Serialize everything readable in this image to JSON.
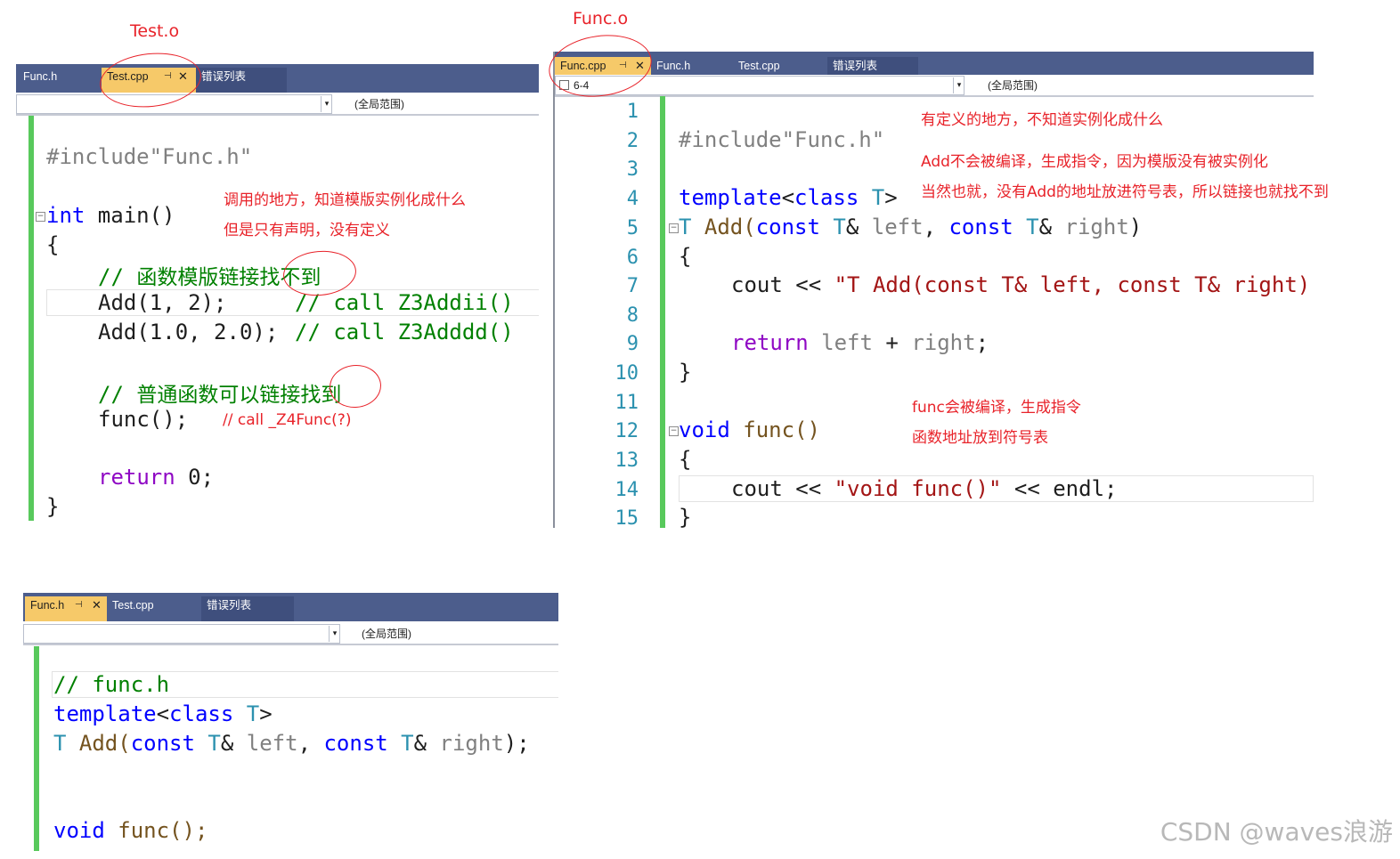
{
  "annotations": {
    "test_o": "Test.o",
    "func_o": "Func.o",
    "call_site_1": "调用的地方，知道模版实例化成什么",
    "call_site_2": "但是只有声明，没有定义",
    "def_site_1": "有定义的地方，不知道实例化成什么",
    "def_site_2": "Add不会被编译，生成指令，因为模版没有被实例化",
    "def_site_3": "当然也就，没有Add的地址放进符号表，所以链接也就找不到",
    "func_site_1": "func会被编译，生成指令",
    "func_site_2": "函数地址放到符号表",
    "func_call_hint": "// call _Z4Func(?)"
  },
  "test_panel": {
    "tabs": [
      "Func.h",
      "Test.cpp",
      "错误列表"
    ],
    "active_tab": "Test.cpp",
    "pin_glyph": "⊣",
    "close_glyph": "✕",
    "scope": "(全局范围)",
    "dropdown_arrow": "▾",
    "code": {
      "include": "#include\"Func.h\"",
      "main_type": "int",
      "main_sig": " main()",
      "open_brace": "{",
      "comment_template_prefix": "// ",
      "comment_template_text": "函数模版链接找不到",
      "add_int_call": "Add(1, 2);",
      "add_int_comment": "// call Z3Addii()",
      "add_double_call": "Add(1.0, 2.0);",
      "add_double_comment": "// call Z3Adddd()",
      "comment_normal_prefix": "// ",
      "comment_normal_text": "普通函数可以链接找到",
      "func_call": "func();",
      "return_kw": "return",
      "return_val": " 0;",
      "close_brace": "}"
    }
  },
  "func_panel": {
    "tabs": [
      "Func.cpp",
      "Func.h",
      "Test.cpp",
      "错误列表"
    ],
    "active_tab": "Func.cpp",
    "pin_glyph": "⊣",
    "close_glyph": "✕",
    "project_dropdown": "6-4",
    "scope": "(全局范围)",
    "dropdown_arrow": "▾",
    "line_numbers": [
      "1",
      "2",
      "3",
      "4",
      "5",
      "6",
      "7",
      "8",
      "9",
      "10",
      "11",
      "12",
      "13",
      "14",
      "15"
    ],
    "code": {
      "include": "#include\"Func.h\"",
      "template_kw": "template",
      "template_lt": "<",
      "class_kw": "class",
      "template_T": " T",
      "template_gt": ">",
      "add_ret": "T",
      "add_name": " Add(",
      "const_kw": "const",
      "T_ref": " T",
      "amp": "&",
      "left": " left",
      "comma": ",",
      "right": " right",
      "close_paren": ")",
      "open_brace": "{",
      "cout": "cout",
      "shift": " << ",
      "add_string": "\"T Add(const T& left, const T& right)",
      "return_kw": "return",
      "return_expr_left": " left",
      "plus": " + ",
      "return_expr_right": "right",
      "semicolon": ";",
      "close_brace": "}",
      "void_kw": "void",
      "func_sig": " func()",
      "func_string": "\"void func()\"",
      "endl": " << endl;"
    }
  },
  "header_panel": {
    "tabs": [
      "Func.h",
      "Test.cpp",
      "错误列表"
    ],
    "active_tab": "Func.h",
    "pin_glyph": "⊣",
    "close_glyph": "✕",
    "scope": "(全局范围)",
    "dropdown_arrow": "▾",
    "code": {
      "comment": "// func.h",
      "template_kw": "template",
      "template_lt": "<",
      "class_kw": "class",
      "template_T": " T",
      "template_gt": ">",
      "add_ret": "T",
      "add_name": " Add(",
      "const_kw": "const",
      "T_ref": " T",
      "amp": "&",
      "left": " left",
      "comma": ",",
      "right": " right",
      "close": ");",
      "void_kw": "void",
      "func_decl": " func();"
    }
  },
  "watermark": "CSDN @waves浪游",
  "colors": {
    "tabbar": "#4c5d8c",
    "active_tab": "#f6c969",
    "keyword": "#0000ff",
    "comment": "#008000",
    "string": "#a31515",
    "annotation": "#e8232a",
    "change_bar": "#58c95c"
  }
}
